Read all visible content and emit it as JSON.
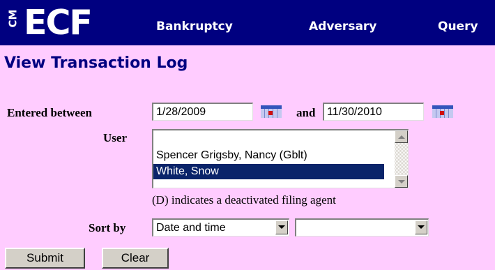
{
  "app": {
    "logo_cm": "CM",
    "logo_ecf": "ECF",
    "nav": [
      "Bankruptcy",
      "Adversary",
      "Query"
    ],
    "colors": {
      "nav_bg": "#000080",
      "page_bg": "#ffccff",
      "title": "#000080",
      "selection": "#0a246a"
    }
  },
  "page": {
    "title": "View Transaction Log"
  },
  "form": {
    "entered_between_label": "Entered between",
    "start_date": "1/28/2009",
    "and_label": "and",
    "end_date": "11/30/2010",
    "calendar_icon": "calendar-icon",
    "user_label": "User",
    "users": [
      {
        "name": "Spencer Grigsby, Nancy (Gblt)",
        "selected": false
      },
      {
        "name": "White, Snow",
        "selected": true
      }
    ],
    "deactivated_note": "(D) indicates a deactivated filing agent",
    "sort_by_label": "Sort by",
    "sort_primary": "Date and time",
    "sort_secondary": "",
    "submit_label": "Submit",
    "clear_label": "Clear"
  }
}
